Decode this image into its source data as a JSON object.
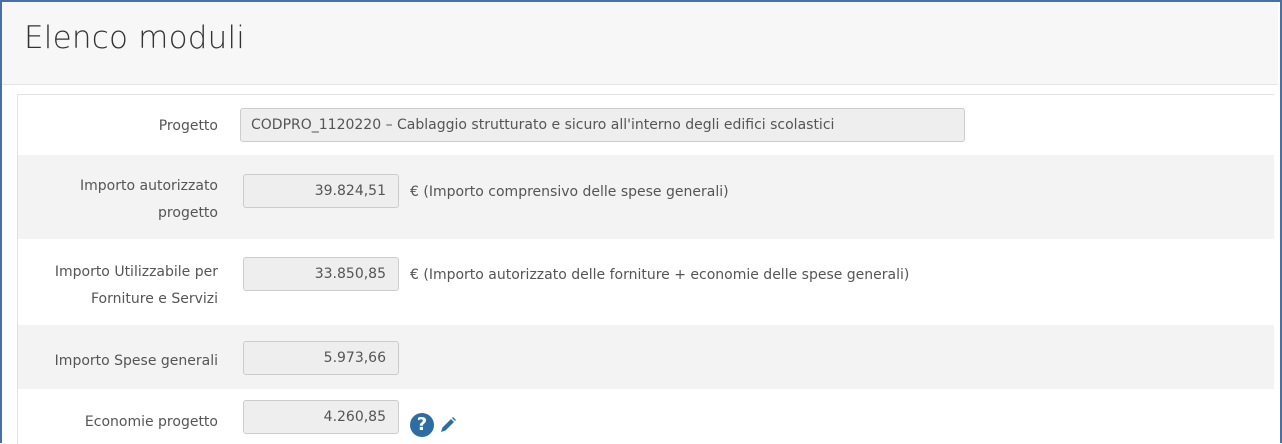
{
  "header": {
    "title": "Elenco moduli"
  },
  "form": {
    "progetto": {
      "label": "Progetto",
      "value": "CODPRO_1120220 – Cablaggio strutturato e sicuro all'interno degli edifici scolastici"
    },
    "importo_autorizzato": {
      "label_line1": "Importo autorizzato",
      "label_line2": "progetto",
      "value": "39.824,51",
      "note": "€ (Importo comprensivo delle spese generali)"
    },
    "importo_utilizzabile": {
      "label_line1": "Importo Utilizzabile per",
      "label_line2": "Forniture e Servizi",
      "value": "33.850,85",
      "note": "€ (Importo autorizzato delle forniture + economie delle spese generali)"
    },
    "importo_spese": {
      "label": "Importo Spese generali",
      "value": "5.973,66"
    },
    "economie": {
      "label": "Economie progetto",
      "value": "4.260,85"
    }
  },
  "icons": {
    "help": "question-circle-icon",
    "edit": "pencil-icon"
  },
  "colors": {
    "accent": "#2e6da4",
    "frame": "#4a6fa5"
  }
}
